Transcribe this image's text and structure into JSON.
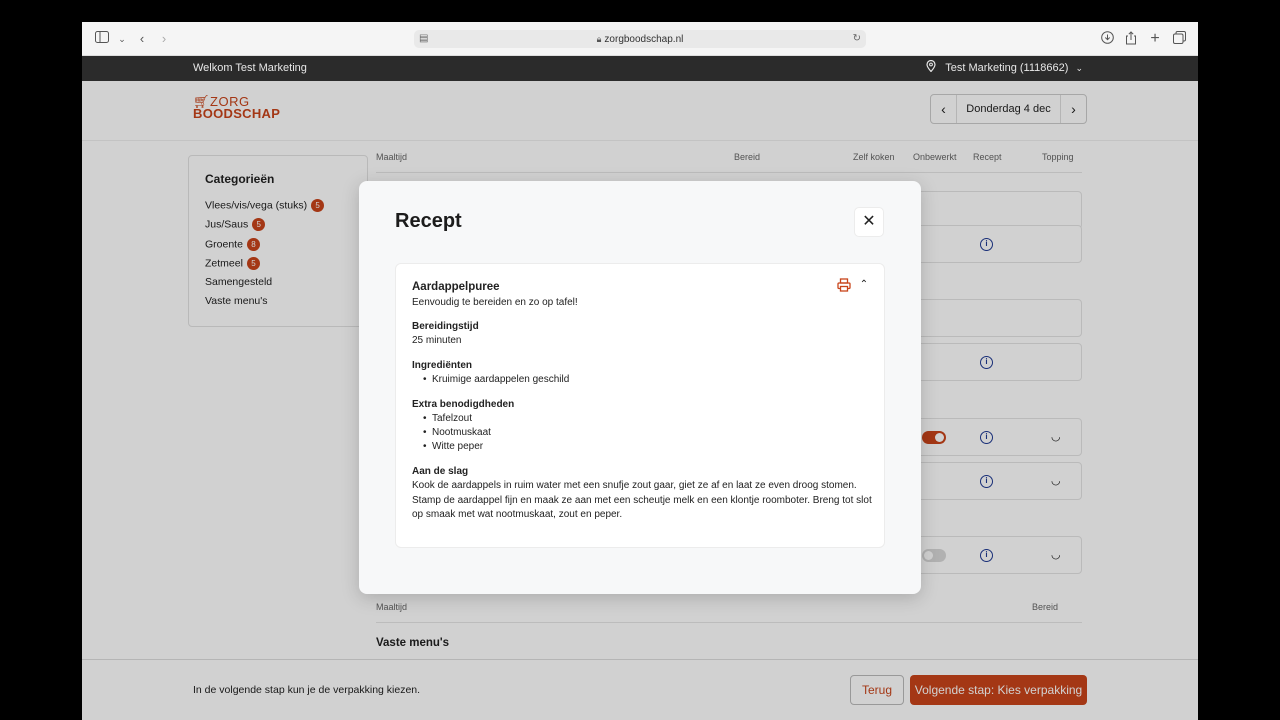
{
  "browser": {
    "url": "zorgboodschap.nl"
  },
  "topbar": {
    "welcome": "Welkom Test Marketing",
    "location": "Test Marketing (1118662)"
  },
  "header": {
    "logo_line1": "ZORG",
    "logo_line2": "BOODSCHAP",
    "date_label": "Donderdag 4 dec"
  },
  "sidebar": {
    "title": "Categorieën",
    "items": [
      {
        "label": "Vlees/vis/vega (stuks)",
        "count": "5"
      },
      {
        "label": "Jus/Saus",
        "count": "5"
      },
      {
        "label": "Groente",
        "count": "8"
      },
      {
        "label": "Zetmeel",
        "count": "5"
      },
      {
        "label": "Samengesteld",
        "count": ""
      },
      {
        "label": "Vaste menu's",
        "count": ""
      }
    ]
  },
  "table": {
    "headers": [
      "Maaltijd",
      "Bereid",
      "Zelf koken",
      "Onbewerkt",
      "Recept",
      "Topping"
    ],
    "bottom_headers": [
      "Maaltijd",
      "Bereid"
    ],
    "vaste_title": "Vaste menu's"
  },
  "footer": {
    "text": "In de volgende stap kun je de verpakking kiezen.",
    "back_label": "Terug",
    "next_label": "Volgende stap: Kies verpakking"
  },
  "modal": {
    "title": "Recept",
    "recipe": {
      "name": "Aardappelpuree",
      "subtitle": "Eenvoudig te bereiden en zo op tafel!",
      "prep_title": "Bereidingstijd",
      "prep_value": "25 minuten",
      "ingredients_title": "Ingrediënten",
      "ingredients": [
        "Kruimige aardappelen geschild"
      ],
      "extras_title": "Extra benodigdheden",
      "extras": [
        "Tafelzout",
        "Nootmuskaat",
        "Witte peper"
      ],
      "steps_title": "Aan de slag",
      "steps": "Kook de aardappels in ruim water met een snufje zout gaar, giet ze af en laat ze even droog stomen. Stamp de aardappel fijn en maak ze aan met een scheutje melk en een klontje roomboter. Breng tot slot op smaak met wat nootmuskaat, zout en peper."
    }
  },
  "colors": {
    "brand": "#c8441a",
    "info_icon": "#1f3a93"
  }
}
